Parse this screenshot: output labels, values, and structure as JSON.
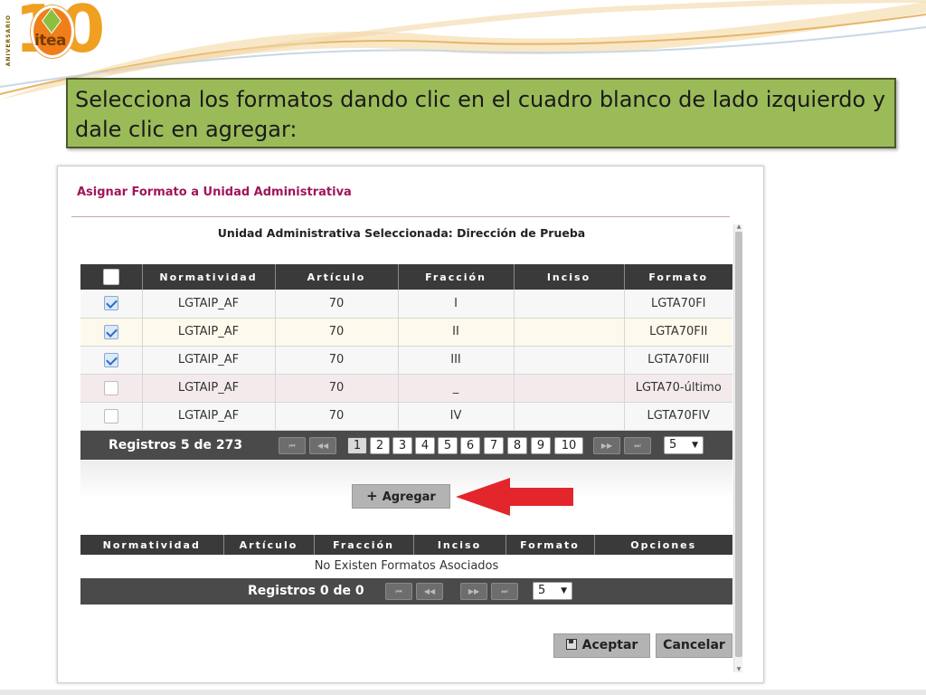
{
  "slide": {
    "logo_text": "itea",
    "logo_number": "10",
    "logo_vertical": "ANIVERSARIO",
    "instruction": "Selecciona los formatos dando clic en el cuadro blanco de lado izquierdo y dale clic en agregar:"
  },
  "dialog": {
    "title": "Asignar Formato a Unidad Administrativa",
    "unit_label": "Unidad Administrativa Seleccionada: Dirección de Prueba",
    "top_table": {
      "headers": [
        "Normatividad",
        "Artículo",
        "Fracción",
        "Inciso",
        "Formato"
      ],
      "rows": [
        {
          "checked": true,
          "normatividad": "LGTAIP_AF",
          "articulo": "70",
          "fraccion": "I",
          "inciso": "",
          "formato": "LGTA70FI"
        },
        {
          "checked": true,
          "normatividad": "LGTAIP_AF",
          "articulo": "70",
          "fraccion": "II",
          "inciso": "",
          "formato": "LGTA70FII"
        },
        {
          "checked": true,
          "normatividad": "LGTAIP_AF",
          "articulo": "70",
          "fraccion": "III",
          "inciso": "",
          "formato": "LGTA70FIII"
        },
        {
          "checked": false,
          "normatividad": "LGTAIP_AF",
          "articulo": "70",
          "fraccion": "_",
          "inciso": "",
          "formato": "LGTA70-último"
        },
        {
          "checked": false,
          "normatividad": "LGTAIP_AF",
          "articulo": "70",
          "fraccion": "IV",
          "inciso": "",
          "formato": "LGTA70FIV"
        }
      ]
    },
    "top_pager": {
      "count": "Registros 5 de 273",
      "pages": [
        "1",
        "2",
        "3",
        "4",
        "5",
        "6",
        "7",
        "8",
        "9",
        "10"
      ],
      "current_page": "1",
      "page_size": "5",
      "first_icon": "⏮",
      "prev_icon": "◀◀",
      "next_icon": "▶▶",
      "last_icon": "⏭"
    },
    "add_button": {
      "label": "Agregar",
      "icon": "+"
    },
    "bottom_table": {
      "headers": [
        "Normatividad",
        "Artículo",
        "Fracción",
        "Inciso",
        "Formato",
        "Opciones"
      ],
      "empty_text": "No Existen Formatos Asociados"
    },
    "bottom_pager": {
      "count": "Registros 0 de 0",
      "page_size": "5"
    },
    "accept_label": "Aceptar",
    "cancel_label": "Cancelar"
  },
  "colors": {
    "instruction_bg": "#9bbb59",
    "title": "#a0155a",
    "grid_header": "#3a3a3a",
    "arrow": "#e3262b"
  }
}
